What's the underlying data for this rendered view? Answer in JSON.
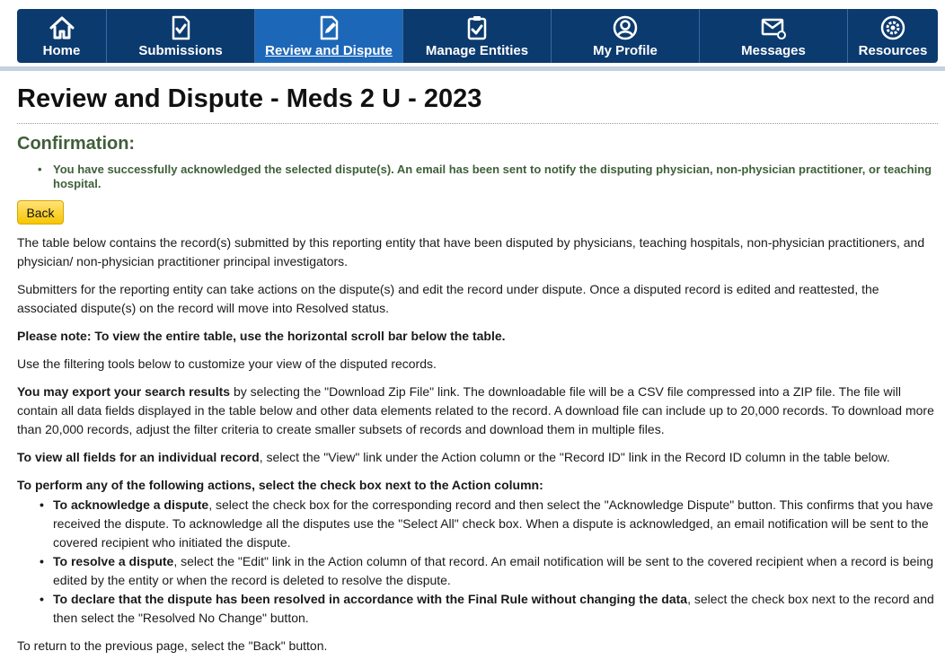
{
  "nav": {
    "items": [
      {
        "label": "Home",
        "icon": "home-icon"
      },
      {
        "label": "Submissions",
        "icon": "document-check-icon"
      },
      {
        "label": "Review and Dispute",
        "icon": "edit-document-icon"
      },
      {
        "label": "Manage Entities",
        "icon": "clipboard-check-icon"
      },
      {
        "label": "My Profile",
        "icon": "user-profile-icon"
      },
      {
        "label": "Messages",
        "icon": "envelope-icon"
      },
      {
        "label": "Resources",
        "icon": "gear-icon"
      }
    ],
    "active_index": 2
  },
  "page": {
    "title": "Review and Dispute - Meds 2 U - 2023"
  },
  "confirmation": {
    "heading": "Confirmation:",
    "message": "You have successfully acknowledged the selected dispute(s). An email has been sent to notify the disputing physician, non-physician practitioner, or teaching hospital."
  },
  "buttons": {
    "back": "Back"
  },
  "content": {
    "p1": "The table below contains the record(s) submitted by this reporting entity that have been disputed by physicians, teaching hospitals, non-physician practitioners, and physician/ non-physician practitioner principal investigators.",
    "p2": "Submitters for the reporting entity can take actions on the dispute(s) and edit the record under dispute. Once a disputed record is edited and reattested, the associated dispute(s) on the record will move into Resolved status.",
    "p3": "Please note: To view the entire table, use the horizontal scroll bar below the table.",
    "p4": "Use the filtering tools below to customize your view of the disputed records.",
    "p5_bold": "You may export your search results",
    "p5_rest": " by selecting the \"Download Zip File\" link. The downloadable file will be a CSV file compressed into a ZIP file. The file will contain all data fields displayed in the table below and other data elements related to the record. A download file can include up to 20,000 records. To download more than 20,000 records, adjust the filter criteria to create smaller subsets of records and download them in multiple files.",
    "p6_bold": "To view all fields for an individual record",
    "p6_rest": ", select the \"View\" link under the Action column or the \"Record ID\" link in the Record ID column in the table below.",
    "p7": "To perform any of the following actions, select the check box next to the Action column:",
    "actions": [
      {
        "bold": "To acknowledge a dispute",
        "rest": ", select the check box for the corresponding record and then select the \"Acknowledge Dispute\" button. This confirms that you have received the dispute. To acknowledge all the disputes use the \"Select All\" check box. When a dispute is acknowledged, an email notification will be sent to the covered recipient who initiated the dispute."
      },
      {
        "bold": "To resolve a dispute",
        "rest": ", select the \"Edit\" link in the Action column of that record. An email notification will be sent to the covered recipient when a record is being edited by the entity or when the record is deleted to resolve the dispute."
      },
      {
        "bold": "To declare that the dispute has been resolved in accordance with the Final Rule without changing the data",
        "rest": ", select the check box next to the record and then select the \"Resolved No Change\" button."
      }
    ],
    "p8": "To return to the previous page, select the \"Back\" button."
  },
  "colors": {
    "nav_bg": "#0b3a6e",
    "nav_active": "#1d67b8",
    "confirm_green": "#3f5f3a",
    "button_yellow": "#f7c600"
  }
}
